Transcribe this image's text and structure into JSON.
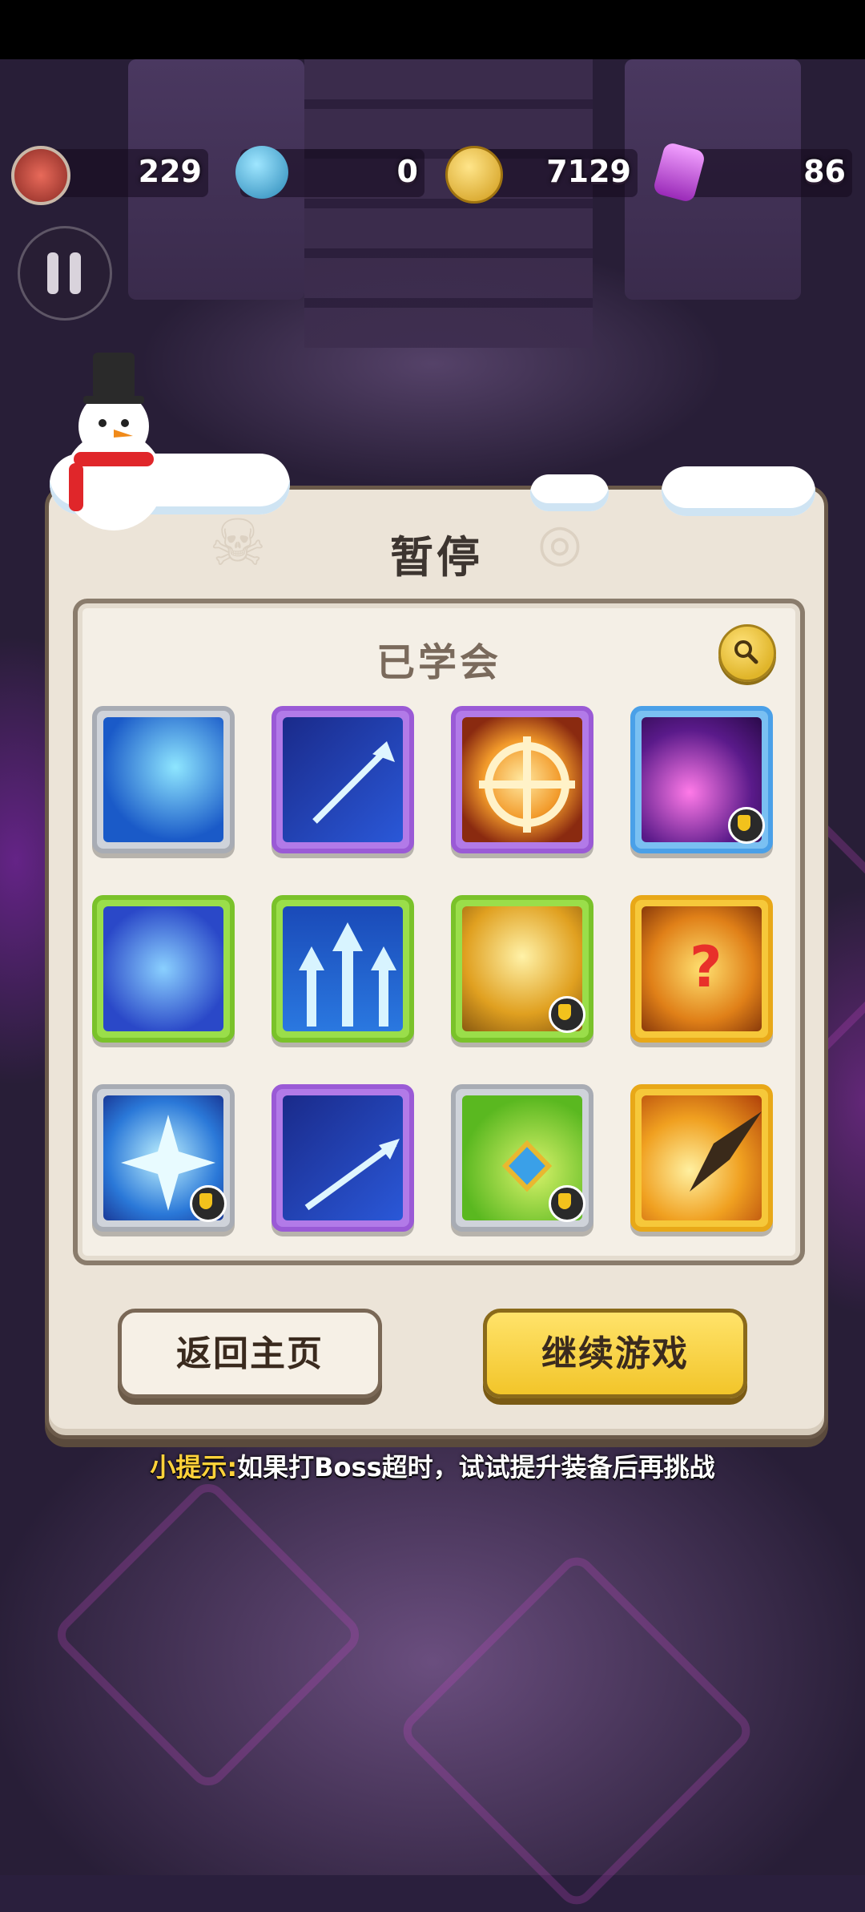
{
  "resources": [
    {
      "icon": "medal-icon",
      "value": "229",
      "color": "#c0504a"
    },
    {
      "icon": "blue-orb-icon",
      "value": "0",
      "color": "#3aa8d8"
    },
    {
      "icon": "gold-coin-icon",
      "value": "7129",
      "color": "#e8b830"
    },
    {
      "icon": "purple-gem-icon",
      "value": "86",
      "color": "#b040c8"
    }
  ],
  "panel": {
    "title": "暂停",
    "learned_title": "已学会",
    "skills": [
      {
        "icon": "ice-tower-skill-icon",
        "frame": "silver",
        "locked": false
      },
      {
        "icon": "ghost-arrow-skill-icon",
        "frame": "purple",
        "locked": false
      },
      {
        "icon": "crosshair-skill-icon",
        "frame": "purple",
        "locked": false
      },
      {
        "icon": "skull-orbit-skill-icon",
        "frame": "blue",
        "locked": true
      },
      {
        "icon": "ice-cube-skill-icon",
        "frame": "green",
        "locked": false
      },
      {
        "icon": "triple-arrow-skill-icon",
        "frame": "green",
        "locked": false
      },
      {
        "icon": "angel-skill-icon",
        "frame": "green",
        "locked": true
      },
      {
        "icon": "mystery-hammer-skill-icon",
        "frame": "gold",
        "locked": false
      },
      {
        "icon": "ice-star-skill-icon",
        "frame": "silver",
        "locked": true
      },
      {
        "icon": "demon-arrow-skill-icon",
        "frame": "purple",
        "locked": false
      },
      {
        "icon": "amulet-arrow-skill-icon",
        "frame": "silver",
        "locked": true
      },
      {
        "icon": "lightning-spear-skill-icon",
        "frame": "gold",
        "locked": false
      }
    ],
    "home_button": "返回主页",
    "continue_button": "继续游戏"
  },
  "tip": {
    "label": "小提示:",
    "text": "如果打Boss超时，试试提升装备后再挑战"
  }
}
